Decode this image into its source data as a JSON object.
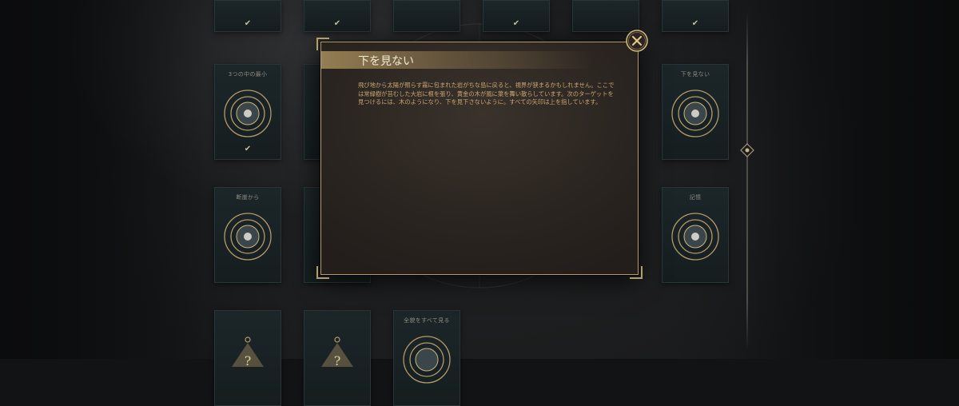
{
  "modal": {
    "title": "下を見ない",
    "body": "飛び地から太陽が照らす霧に包まれた岩がちな島に戻ると、視界が狭まるかもしれません。ここでは常緑樹が苔むした大岩に根を張り、黄金の木が風に葉を舞い散らしています。次のターゲットを見つけるには、木のようになり、下を見下さないように。すべての矢印は上を指しています。"
  },
  "cards": {
    "left_row1_title": "3つの中の最小",
    "left_row2_title": "断崖から",
    "right_row1_title": "下を見ない",
    "right_row2_title": "記憶",
    "bottom_card_title": "全貌をすべて見る",
    "completed_mark": "✔",
    "mystery_mark": "?"
  },
  "colors": {
    "gold_accent": "#b59d6b",
    "body_text": "#c9a873",
    "card_bg": "#1a2325"
  },
  "icons": {
    "close": "close-x-icon",
    "target": "concentric-target-icon",
    "timeline_node": "diamond-node-icon"
  }
}
